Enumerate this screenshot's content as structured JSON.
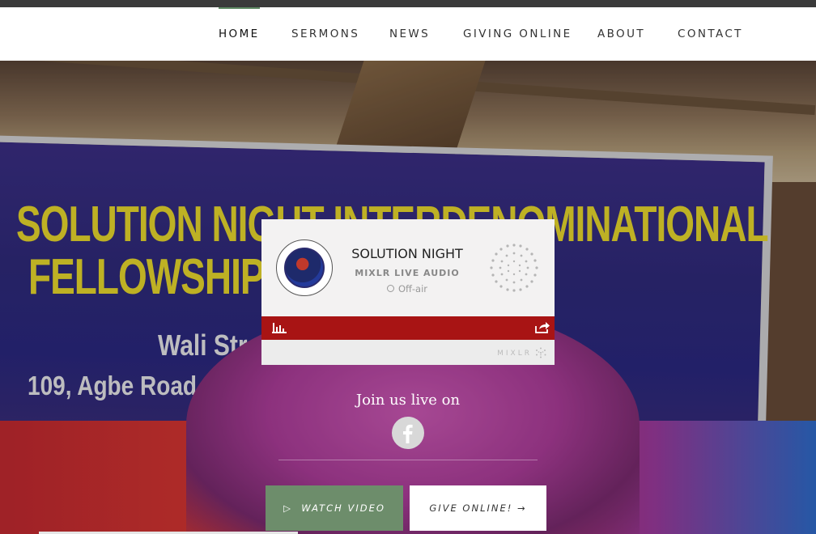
{
  "nav": {
    "items": [
      {
        "label": "HOME",
        "active": true
      },
      {
        "label": "SERMONS"
      },
      {
        "label": "NEWS"
      },
      {
        "label": "GIVING ONLINE"
      },
      {
        "label": "ABOUT"
      },
      {
        "label": "CONTACT"
      }
    ]
  },
  "hero_banner": {
    "line1": "SOLUTION NIGHT INTERDENOMINATIONAL",
    "line2": "FELLOWSHIP & OUTREACH",
    "line3": "Wali Street, ... State.",
    "line4": "109, Agbe Road, Off ... B/Stop, Abule-Egba, Lagos."
  },
  "player": {
    "title": "SOLUTION NIGHT",
    "subtitle": "MIXLR LIVE AUDIO",
    "status": "Off-air",
    "brand": "MIXLR",
    "icons": {
      "logo": "church-logo",
      "equalizer": "equalizer-icon",
      "share": "share-icon",
      "dots": "mixlr-dots-icon"
    },
    "bar_color": "#a81414"
  },
  "social": {
    "join_text": "Join us live on",
    "icon": "facebook-icon"
  },
  "buttons": {
    "watch_label": "WATCH VIDEO",
    "give_label": "GIVE ONLINE!",
    "watch_color": "#6d8d6b"
  },
  "colors": {
    "accent": "#5f8a64",
    "player_bar": "#a81414"
  }
}
